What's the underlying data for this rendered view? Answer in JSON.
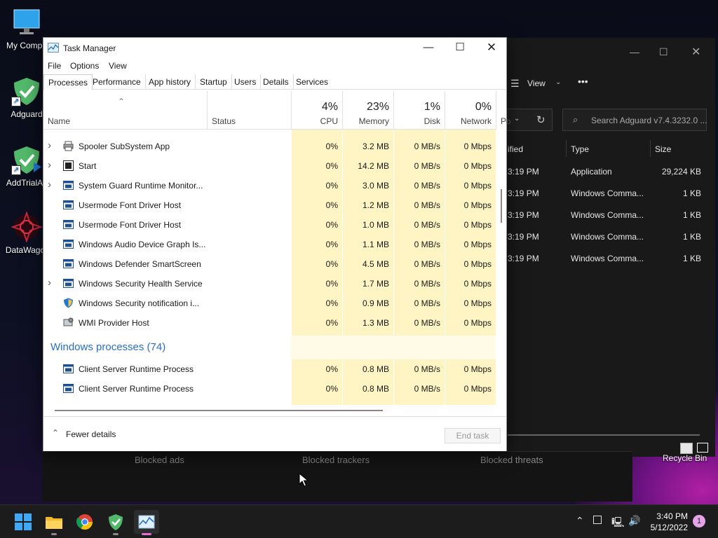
{
  "desktop": {
    "icons": [
      {
        "label": "My Compu"
      },
      {
        "label": "Adguard"
      },
      {
        "label": "AddTrialAc"
      },
      {
        "label": "DataWagor"
      }
    ],
    "recycle_bin": "Recycle Bin"
  },
  "explorer": {
    "view_label": "View",
    "more_label": "•••",
    "search_placeholder": "Search Adguard v7.4.3232.0 ...",
    "headers": {
      "modified": "ified",
      "type": "Type",
      "size": "Size"
    },
    "rows": [
      {
        "modified": "3:19 PM",
        "type": "Application",
        "size": "29,224 KB"
      },
      {
        "modified": "3:19 PM",
        "type": "Windows Comma...",
        "size": "1 KB"
      },
      {
        "modified": "3:19 PM",
        "type": "Windows Comma...",
        "size": "1 KB"
      },
      {
        "modified": "3:19 PM",
        "type": "Windows Comma...",
        "size": "1 KB"
      },
      {
        "modified": "3:19 PM",
        "type": "Windows Comma...",
        "size": "1 KB"
      }
    ]
  },
  "adguard": {
    "blocked_ads": "Blocked ads",
    "blocked_trackers": "Blocked trackers",
    "blocked_threats": "Blocked threats"
  },
  "task_manager": {
    "title": "Task Manager",
    "menu": [
      "File",
      "Options",
      "View"
    ],
    "tabs": [
      "Processes",
      "Performance",
      "App history",
      "Startup",
      "Users",
      "Details",
      "Services"
    ],
    "active_tab": "Processes",
    "columns": {
      "name": "Name",
      "status": "Status",
      "cpu": {
        "label": "CPU",
        "pct": "4%"
      },
      "memory": {
        "label": "Memory",
        "pct": "23%"
      },
      "disk": {
        "label": "Disk",
        "pct": "1%"
      },
      "network": {
        "label": "Network",
        "pct": "0%"
      },
      "power": "Po"
    },
    "processes": [
      {
        "expandable": true,
        "icon": "printer-icon",
        "name": "Spooler SubSystem App",
        "cpu": "0%",
        "memory": "3.2 MB",
        "disk": "0 MB/s",
        "network": "0 Mbps"
      },
      {
        "expandable": true,
        "icon": "start-icon",
        "name": "Start",
        "cpu": "0%",
        "memory": "14.2 MB",
        "disk": "0 MB/s",
        "network": "0 Mbps"
      },
      {
        "expandable": true,
        "icon": "app-window-icon",
        "name": "System Guard Runtime Monitor...",
        "cpu": "0%",
        "memory": "3.0 MB",
        "disk": "0 MB/s",
        "network": "0 Mbps"
      },
      {
        "expandable": false,
        "icon": "app-window-icon",
        "name": "Usermode Font Driver Host",
        "cpu": "0%",
        "memory": "1.2 MB",
        "disk": "0 MB/s",
        "network": "0 Mbps"
      },
      {
        "expandable": false,
        "icon": "app-window-icon",
        "name": "Usermode Font Driver Host",
        "cpu": "0%",
        "memory": "1.0 MB",
        "disk": "0 MB/s",
        "network": "0 Mbps"
      },
      {
        "expandable": false,
        "icon": "app-window-icon",
        "name": "Windows Audio Device Graph Is...",
        "cpu": "0%",
        "memory": "1.1 MB",
        "disk": "0 MB/s",
        "network": "0 Mbps"
      },
      {
        "expandable": false,
        "icon": "app-window-icon",
        "name": "Windows Defender SmartScreen",
        "cpu": "0%",
        "memory": "4.5 MB",
        "disk": "0 MB/s",
        "network": "0 Mbps"
      },
      {
        "expandable": true,
        "icon": "app-window-icon",
        "name": "Windows Security Health Service",
        "cpu": "0%",
        "memory": "1.7 MB",
        "disk": "0 MB/s",
        "network": "0 Mbps"
      },
      {
        "expandable": false,
        "icon": "security-shield-icon",
        "name": "Windows Security notification i...",
        "cpu": "0%",
        "memory": "0.9 MB",
        "disk": "0 MB/s",
        "network": "0 Mbps"
      },
      {
        "expandable": false,
        "icon": "wmi-icon",
        "name": "WMI Provider Host",
        "cpu": "0%",
        "memory": "1.3 MB",
        "disk": "0 MB/s",
        "network": "0 Mbps"
      }
    ],
    "group_label": "Windows processes (74)",
    "windows_processes": [
      {
        "expandable": false,
        "icon": "app-window-icon",
        "name": "Client Server Runtime Process",
        "cpu": "0%",
        "memory": "0.8 MB",
        "disk": "0 MB/s",
        "network": "0 Mbps"
      },
      {
        "expandable": false,
        "icon": "app-window-icon",
        "name": "Client Server Runtime Process",
        "cpu": "0%",
        "memory": "0.8 MB",
        "disk": "0 MB/s",
        "network": "0 Mbps"
      }
    ],
    "fewer_details": "Fewer details",
    "end_task": "End task"
  },
  "taskbar": {
    "apps": [
      "start-icon",
      "file-explorer-icon",
      "chrome-icon",
      "adguard-icon",
      "task-manager-icon"
    ],
    "time": "3:40 PM",
    "date": "5/12/2022",
    "notifications": "1"
  },
  "colors": {
    "heat": "#fff4c4",
    "heat_group": "#fffbe6",
    "accent": "#2a6fbf"
  }
}
